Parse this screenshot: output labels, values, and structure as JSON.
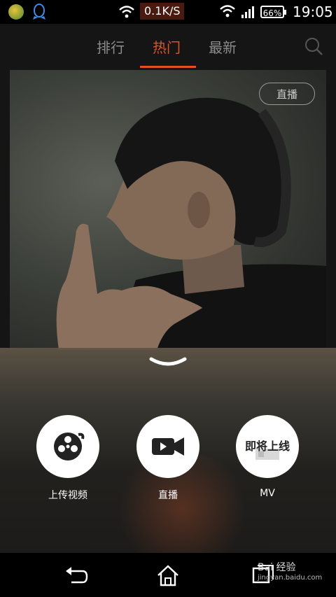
{
  "status_bar": {
    "net_speed": "0.1K/S",
    "battery": "66%",
    "time": "19:05"
  },
  "tabs": [
    {
      "label": "排行"
    },
    {
      "label": "热门"
    },
    {
      "label": "最新"
    }
  ],
  "preview": {
    "badge": "直播"
  },
  "actions": [
    {
      "label": "上传视频",
      "icon": "film-reel-icon"
    },
    {
      "label": "直播",
      "icon": "video-camera-icon"
    },
    {
      "label": "MV",
      "icon": "coming-soon-badge",
      "overlay": "即将上线"
    }
  ],
  "watermark": {
    "text": "Bai 经验",
    "sub": "jingyan.baidu.com"
  },
  "colors": {
    "accent": "#e0521f",
    "tab_inactive": "#8c8c8c"
  }
}
